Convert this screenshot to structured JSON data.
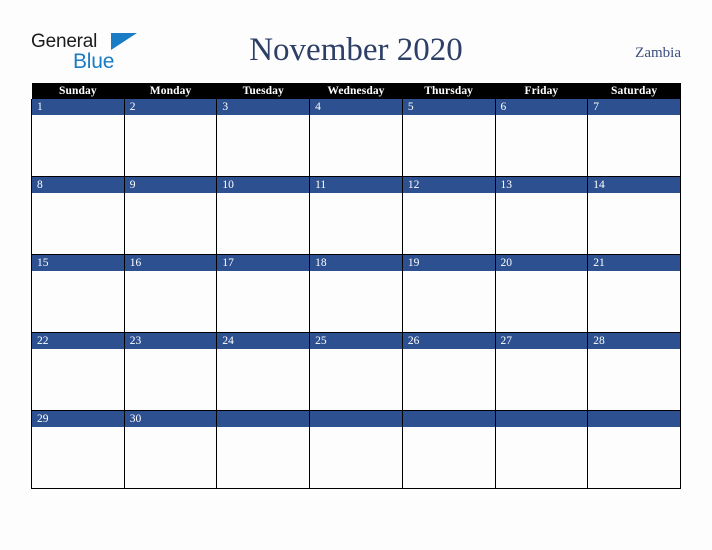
{
  "brand": {
    "name_part1": "General",
    "name_part2": "Blue",
    "triangle_icon": "triangle-icon",
    "accent_color": "#1a7cc4"
  },
  "header": {
    "title": "November 2020",
    "month": "November",
    "year": "2020",
    "country": "Zambia",
    "title_color": "#2d3f66"
  },
  "calendar": {
    "header_bg": "#000000",
    "header_text_color": "#ffffff",
    "date_band_color": "#2d5190",
    "date_text_color": "#ffffff",
    "cell_bg": "#fdfdfd",
    "border_color": "#000000",
    "weekday_headers": [
      "Sunday",
      "Monday",
      "Tuesday",
      "Wednesday",
      "Thursday",
      "Friday",
      "Saturday"
    ],
    "weeks": [
      {
        "days": [
          {
            "date": "1",
            "empty": false
          },
          {
            "date": "2",
            "empty": false
          },
          {
            "date": "3",
            "empty": false
          },
          {
            "date": "4",
            "empty": false
          },
          {
            "date": "5",
            "empty": false
          },
          {
            "date": "6",
            "empty": false
          },
          {
            "date": "7",
            "empty": false
          }
        ]
      },
      {
        "days": [
          {
            "date": "8",
            "empty": false
          },
          {
            "date": "9",
            "empty": false
          },
          {
            "date": "10",
            "empty": false
          },
          {
            "date": "11",
            "empty": false
          },
          {
            "date": "12",
            "empty": false
          },
          {
            "date": "13",
            "empty": false
          },
          {
            "date": "14",
            "empty": false
          }
        ]
      },
      {
        "days": [
          {
            "date": "15",
            "empty": false
          },
          {
            "date": "16",
            "empty": false
          },
          {
            "date": "17",
            "empty": false
          },
          {
            "date": "18",
            "empty": false
          },
          {
            "date": "19",
            "empty": false
          },
          {
            "date": "20",
            "empty": false
          },
          {
            "date": "21",
            "empty": false
          }
        ]
      },
      {
        "days": [
          {
            "date": "22",
            "empty": false
          },
          {
            "date": "23",
            "empty": false
          },
          {
            "date": "24",
            "empty": false
          },
          {
            "date": "25",
            "empty": false
          },
          {
            "date": "26",
            "empty": false
          },
          {
            "date": "27",
            "empty": false
          },
          {
            "date": "28",
            "empty": false
          }
        ]
      },
      {
        "days": [
          {
            "date": "29",
            "empty": false
          },
          {
            "date": "30",
            "empty": false
          },
          {
            "date": "",
            "empty": true
          },
          {
            "date": "",
            "empty": true
          },
          {
            "date": "",
            "empty": true
          },
          {
            "date": "",
            "empty": true
          },
          {
            "date": "",
            "empty": true
          }
        ]
      }
    ]
  }
}
